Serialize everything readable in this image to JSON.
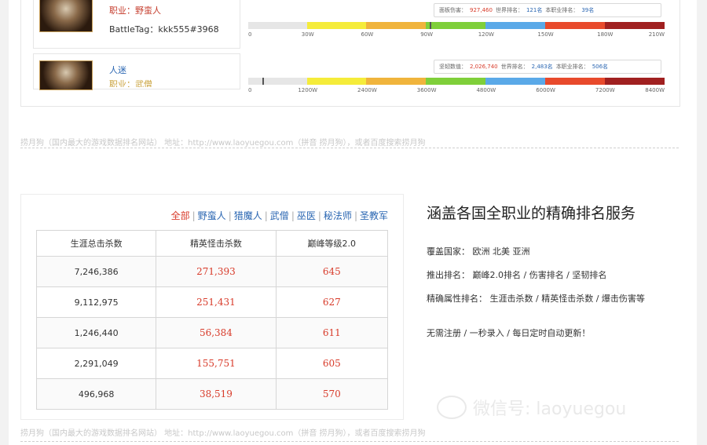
{
  "hero1": {
    "class_line": "职业：野蛮人",
    "battletag": "BattleTag：kkk555#3968",
    "stats": {
      "label1": "面板伤害：",
      "value1": "927,460",
      "label2": "世界排名：",
      "value2": "121名",
      "label3": "本职业排名：",
      "value3": "39名"
    },
    "ticks": [
      "0",
      "30W",
      "60W",
      "90W",
      "120W",
      "150W",
      "180W",
      "210W"
    ]
  },
  "hero2": {
    "name": "人迷",
    "class_line": "职业：武僧",
    "stats": {
      "label1": "坚韧数值：",
      "value1": "2,026,740",
      "label2": "世界排名：",
      "value2": "2,483名",
      "label3": "本职业排名：",
      "value3": "506名"
    },
    "ticks": [
      "0",
      "1200W",
      "2400W",
      "3600W",
      "4800W",
      "6000W",
      "7200W",
      "8400W"
    ]
  },
  "footer": {
    "text": "捞月狗（国内最大的游戏数据排名网站） 地址：http://www.laoyuegou.com（拼音 捞月狗），或者百度搜索捞月狗"
  },
  "filters": [
    "全部",
    "野蛮人",
    "猎魔人",
    "武僧",
    "巫医",
    "秘法师",
    "圣教军"
  ],
  "table": {
    "headers": [
      "生涯总击杀数",
      "精英怪击杀数",
      "巅峰等级2.0"
    ],
    "rows": [
      [
        "7,246,386",
        "271,393",
        "645"
      ],
      [
        "9,112,975",
        "251,431",
        "627"
      ],
      [
        "1,246,440",
        "56,384",
        "611"
      ],
      [
        "2,291,049",
        "155,751",
        "605"
      ],
      [
        "496,968",
        "38,519",
        "570"
      ]
    ]
  },
  "feature": {
    "title": "涵盖各国全职业的精确排名服务",
    "line1": "覆盖国家： 欧洲 北美 亚洲",
    "line2": "推出排名： 巅峰2.0排名 / 伤害排名 / 坚韧排名",
    "line3": "精确属性排名： 生涯击杀数 / 精英怪击杀数 / 爆击伤害等",
    "line4": "无需注册 / 一秒录入 / 每日定时自动更新！"
  },
  "watermark": "微信号: laoyuegou",
  "colors": {
    "accent_red": "#d83b2a",
    "link_blue": "#2a66b2",
    "bar_gray": "#e6e6e6",
    "bar_yellow": "#f5ec3a",
    "bar_orange": "#f0b43c",
    "bar_green": "#7fcf3a",
    "bar_blue": "#5aa9e8",
    "bar_red": "#e84a2c",
    "bar_darkred": "#a02020"
  }
}
